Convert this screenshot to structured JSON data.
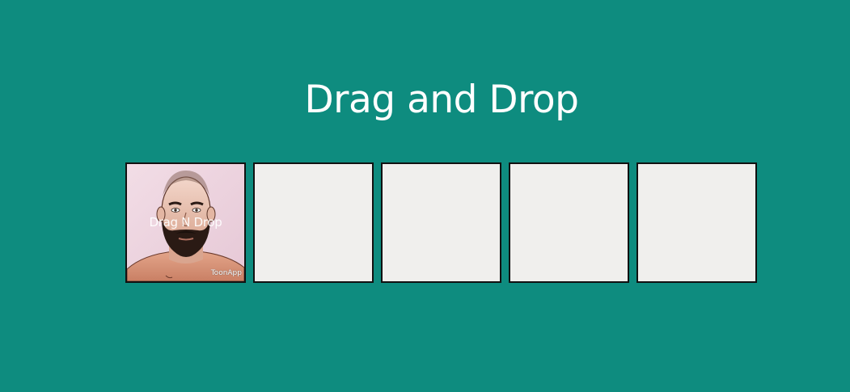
{
  "page": {
    "title": "Drag and Drop",
    "background_color": "#0e8c7f"
  },
  "draggable_item": {
    "label": "Drag N Drop",
    "watermark": "ToonApp",
    "image": "cartoon-portrait-of-bearded-man"
  },
  "drop_zones": [
    {
      "contains_item": true
    },
    {
      "contains_item": false
    },
    {
      "contains_item": false
    },
    {
      "contains_item": false
    },
    {
      "contains_item": false
    }
  ]
}
